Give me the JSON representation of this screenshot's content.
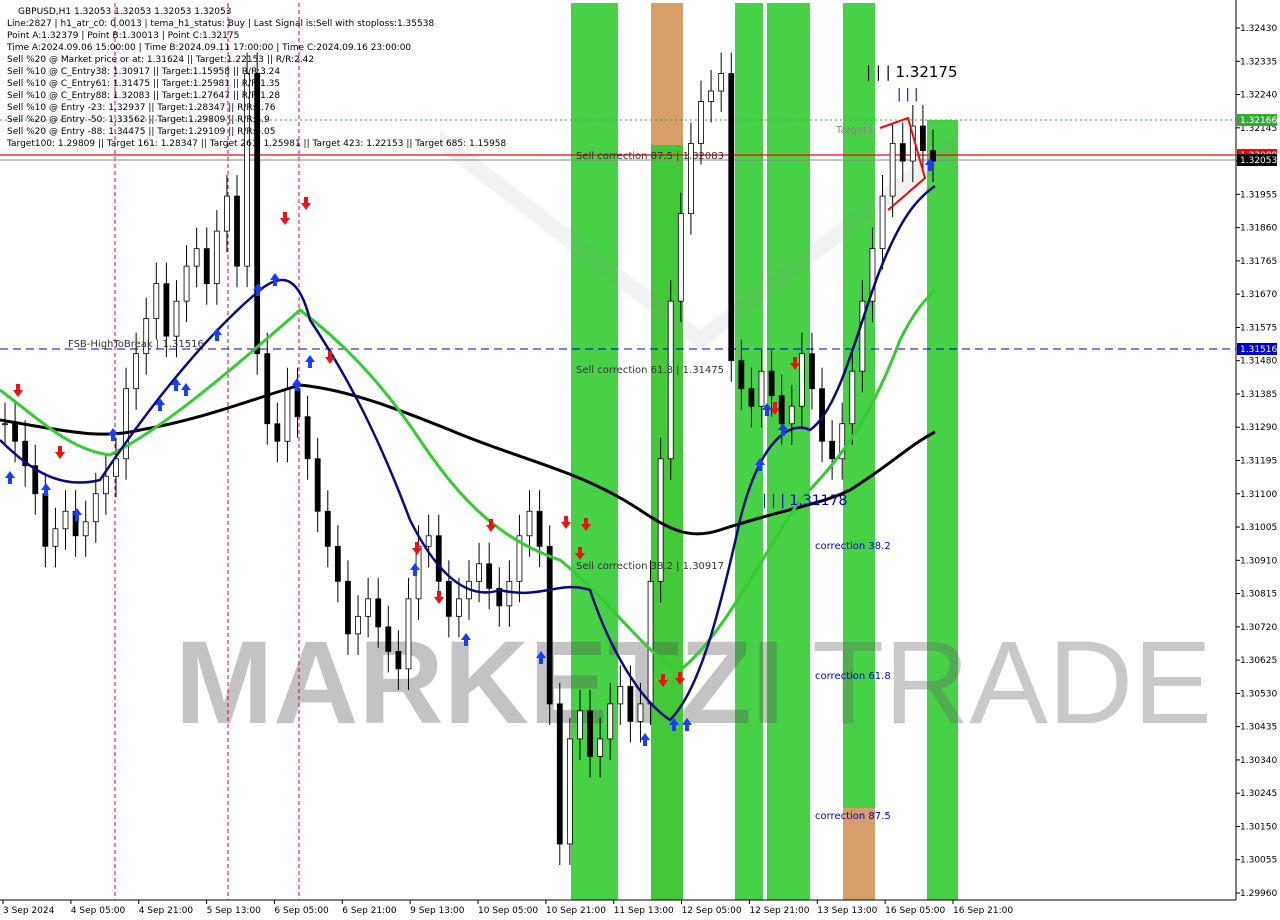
{
  "header": {
    "symbol_line": "GBPUSD,H1  1.32053 1.32053 1.32053 1.32053",
    "lines": [
      "Line:2827 | h1_atr_c0: 0.0013 | tema_h1_status: Buy | Last Signal is:Sell with stoploss:1.35538",
      "Point A:1.32379 | Point B:1.30013 | Point C:1.32175",
      "Time A:2024.09.06 15:00:00 | Time B:2024.09.11 17:00:00 | Time C:2024.09.16 23:00:00",
      "Sell %20 @ Market price or at: 1.31624 || Target:1.22153 || R/R:2.42",
      "Sell %10 @ C_Entry38: 1.30917 || Target:1.15958 || R/R:3.24",
      "Sell %10 @ C_Entry61: 1.31475 || Target:1.25981 || R/R:1.35",
      "Sell %10 @ C_Entry88: 1.32083 || Target:1.27647 || R/R:1.28",
      "Sell %10 @ Entry -23: 1.32937 || Target:1.28347 || R/R:1.76",
      "Sell %20 @ Entry -50: 1.33562 || Target:1.29809 || R/R:1.9",
      "Sell %20 @ Entry -88: 1.34475 || Target:1.29109 || R/R:5.05",
      "Target100: 1.29809 || Target 161: 1.28347 || Target 261: 1.25981 || Target 423: 1.22153 || Target 685: 1.15958"
    ]
  },
  "watermark": {
    "left": "MARKETZI",
    "right": "TRADE"
  },
  "annotations": {
    "sell_correction_875": "Sell correction 87.5 | 1.32083",
    "sell_correction_618": "Sell correction 61.8 | 1.31475",
    "sell_correction_382": "Sell correction 38.2 | 1.30917",
    "fsb_high": "FSB-HighToBreak | 1.31516",
    "point_c": "| | | 1.32175",
    "point_c_ticks": "| | |",
    "point_b": "| | | 1.31178",
    "target1": "Target1",
    "correction_382": "correction 38.2",
    "correction_618": "correction 61.8",
    "correction_875": "correction 87.5"
  },
  "price_tags": {
    "green": "1.32166",
    "red": "1.32089",
    "current": "1.32053",
    "blue": "1.31516"
  },
  "colors": {
    "green_zone": "#33cc33",
    "orange_zone": "#d2955a",
    "bull_candle": "#000000",
    "bear_candle": "#000000",
    "ma_black": "#000000",
    "ma_navy": "#0a0a80",
    "ma_green": "#33cc33",
    "red_line": "#ff0000",
    "blue_dash": "#0000cc",
    "green_tag": "#33aa33",
    "red_tag": "#ff0000",
    "current_tag": "#000000"
  },
  "chart_data": {
    "type": "candlestick",
    "title": "GBPUSD,H1",
    "y_ticks": [
      "1.32430",
      "1.32335",
      "1.32240",
      "1.32145",
      "1.32050",
      "1.31955",
      "1.31860",
      "1.31765",
      "1.31670",
      "1.31575",
      "1.31480",
      "1.31385",
      "1.31290",
      "1.31195",
      "1.31100",
      "1.31005",
      "1.30910",
      "1.30815",
      "1.30720",
      "1.30625",
      "1.30530",
      "1.30435",
      "1.30340",
      "1.30245",
      "1.30150",
      "1.30055",
      "1.29960"
    ],
    "ylim": [
      1.2994,
      1.32475
    ],
    "x_ticks": [
      "3 Sep 2024",
      "4 Sep 05:00",
      "4 Sep 21:00",
      "5 Sep 13:00",
      "6 Sep 05:00",
      "6 Sep 21:00",
      "9 Sep 13:00",
      "10 Sep 05:00",
      "10 Sep 21:00",
      "11 Sep 13:00",
      "12 Sep 05:00",
      "12 Sep 21:00",
      "13 Sep 13:00",
      "16 Sep 05:00",
      "16 Sep 21:00"
    ],
    "levels": {
      "fsb_high": 1.31516,
      "green_dotted": 1.32166,
      "red_line": 1.32089,
      "current": 1.32053
    },
    "close_series": [
      1.313,
      1.3125,
      1.3118,
      1.311,
      1.3095,
      1.31,
      1.3105,
      1.3098,
      1.3102,
      1.311,
      1.3115,
      1.312,
      1.314,
      1.315,
      1.316,
      1.317,
      1.3155,
      1.3165,
      1.3175,
      1.318,
      1.317,
      1.3185,
      1.3195,
      1.3175,
      1.323,
      1.315,
      1.313,
      1.3125,
      1.314,
      1.3132,
      1.312,
      1.3105,
      1.3095,
      1.3085,
      1.307,
      1.3075,
      1.308,
      1.3072,
      1.3065,
      1.306,
      1.308,
      1.3095,
      1.3098,
      1.3085,
      1.3075,
      1.308,
      1.3085,
      1.309,
      1.3083,
      1.3078,
      1.3085,
      1.3098,
      1.3105,
      1.3095,
      1.305,
      1.301,
      1.304,
      1.3048,
      1.3035,
      1.304,
      1.305,
      1.3055,
      1.3045,
      1.305,
      1.3085,
      1.312,
      1.3165,
      1.319,
      1.321,
      1.3222,
      1.3225,
      1.323,
      1.3148,
      1.314,
      1.3135,
      1.3145,
      1.3138,
      1.313,
      1.3135,
      1.315,
      1.314,
      1.3125,
      1.312,
      1.313,
      1.3145,
      1.3165,
      1.318,
      1.3195,
      1.321,
      1.3205,
      1.3215,
      1.3208,
      1.3205
    ]
  }
}
